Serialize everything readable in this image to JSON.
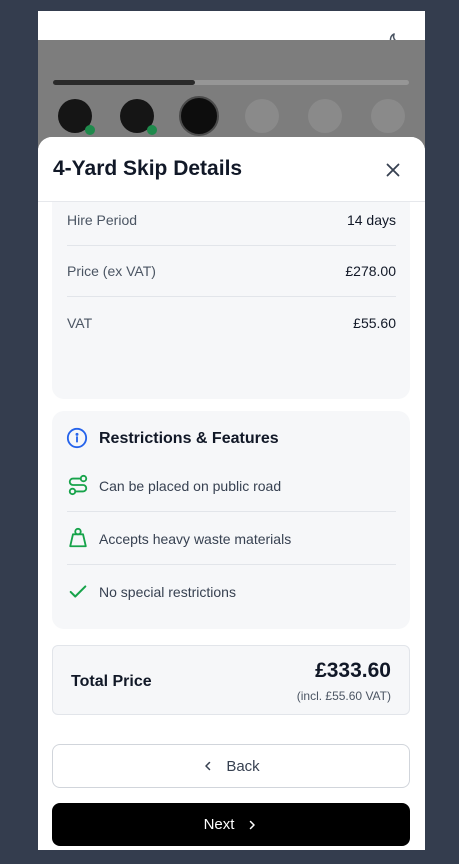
{
  "modal": {
    "title": "4-Yard Skip Details"
  },
  "details": [
    {
      "label": "Hire Period",
      "value": "14 days"
    },
    {
      "label": "Price (ex VAT)",
      "value": "£278.00"
    },
    {
      "label": "VAT",
      "value": "£55.60"
    }
  ],
  "restrictions": {
    "title": "Restrictions & Features",
    "items": [
      {
        "icon": "route-icon",
        "text": "Can be placed on public road"
      },
      {
        "icon": "weight-icon",
        "text": "Accepts heavy waste materials"
      },
      {
        "icon": "check-icon",
        "text": "No special restrictions"
      }
    ]
  },
  "total": {
    "label": "Total Price",
    "amount": "£333.60",
    "note": "(incl. £55.60 VAT)"
  },
  "buttons": {
    "back": "Back",
    "next": "Next"
  },
  "progress": {
    "steps_total": 6,
    "steps_completed": 2,
    "current_step": 3,
    "fraction": 0.4
  },
  "colors": {
    "accent_blue": "#2563eb",
    "success_green": "#16a34a",
    "backdrop": "#343d4e",
    "primary_button": "#000000"
  }
}
